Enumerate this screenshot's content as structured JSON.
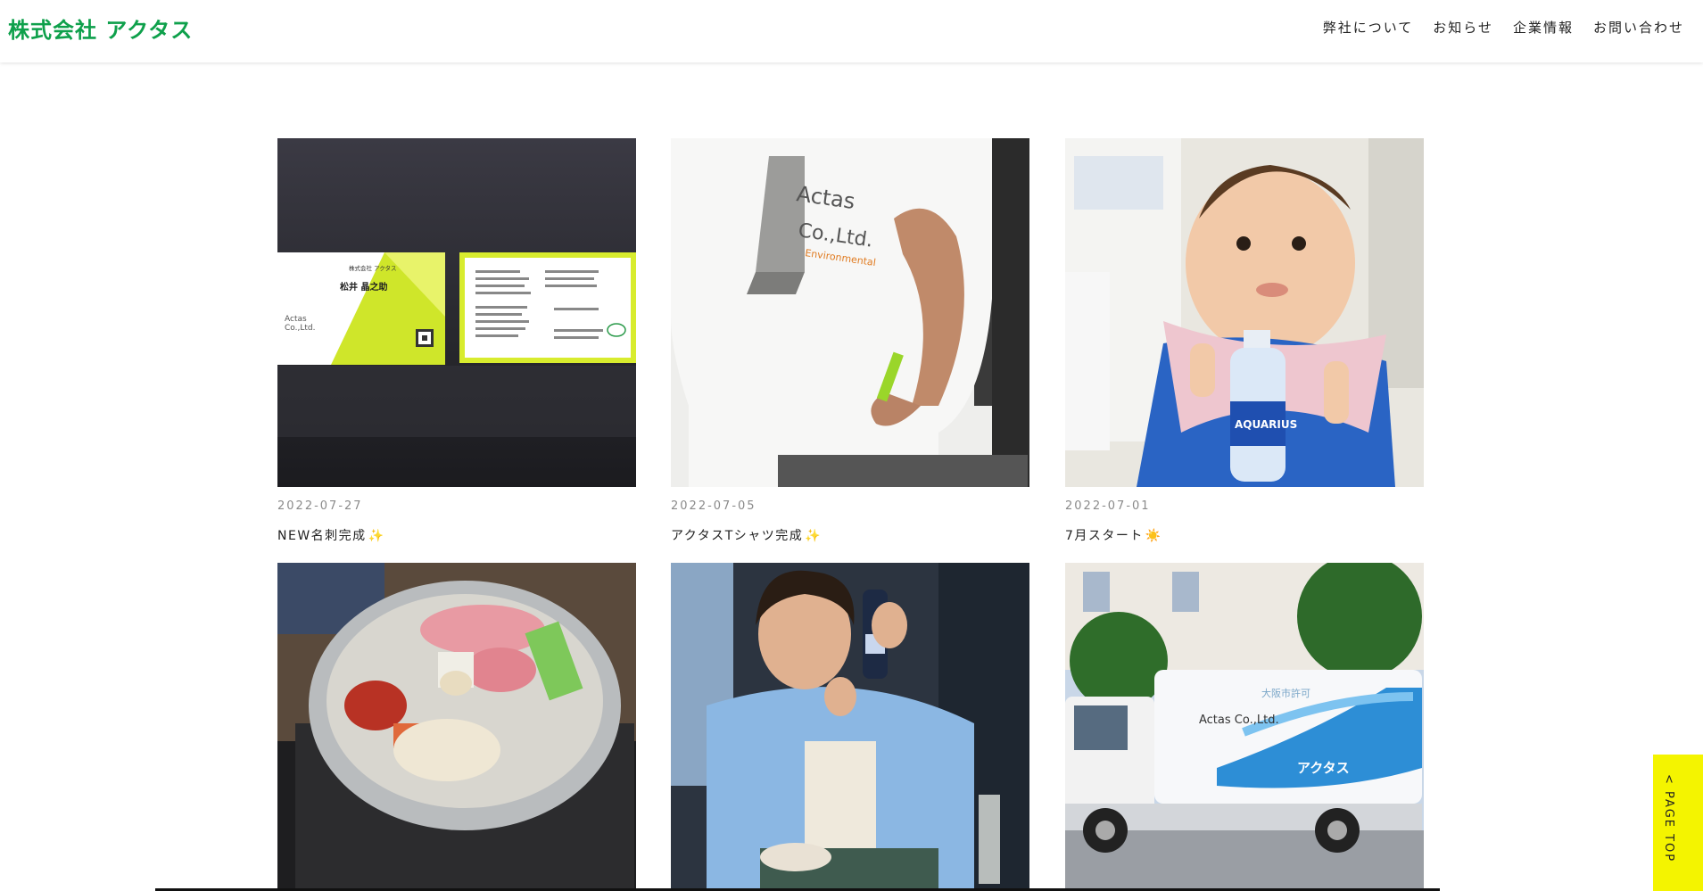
{
  "header": {
    "logo": "株式会社 アクタス",
    "nav": [
      "弊社について",
      "お知らせ",
      "企業情報",
      "お問い合わせ"
    ]
  },
  "posts": [
    {
      "date": "2022-07-27",
      "title": "NEW名刺完成",
      "emoji": "✨"
    },
    {
      "date": "2022-07-05",
      "title": "アクタスTシャツ完成",
      "emoji": "✨"
    },
    {
      "date": "2022-07-01",
      "title": "7月スタート",
      "emoji": "☀️"
    },
    {
      "date": "",
      "title": "",
      "emoji": ""
    },
    {
      "date": "",
      "title": "",
      "emoji": ""
    },
    {
      "date": "",
      "title": "",
      "emoji": ""
    }
  ],
  "photo_text": {
    "card_company": "株式会社 アクタス",
    "card_name": "松井 晶之助",
    "tshirt_line1": "Actas",
    "tshirt_line2": "Co.,Ltd.",
    "tshirt_line3": "Environmental",
    "bottle": "AQUARIUS",
    "truck_brand": "Actas Co.,Ltd.",
    "truck_name": "アクタス",
    "truck_city": "大阪市許可"
  },
  "page_top": "< PAGE TOP",
  "colors": {
    "brand_green": "#0ea04b",
    "page_top_bg": "#f4f400"
  }
}
